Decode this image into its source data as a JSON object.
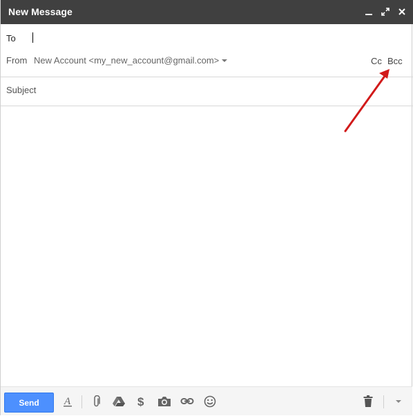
{
  "window": {
    "title": "New Message"
  },
  "compose": {
    "to_label": "To",
    "from_label": "From",
    "from_value": "New Account <my_new_account@gmail.com>",
    "cc_label": "Cc",
    "bcc_label": "Bcc",
    "subject_placeholder": "Subject"
  },
  "toolbar": {
    "send_label": "Send",
    "icons": [
      "formatting-icon",
      "attach-icon",
      "drive-icon",
      "money-icon",
      "photo-icon",
      "link-icon",
      "emoji-icon",
      "trash-icon",
      "more-options-icon"
    ]
  },
  "colors": {
    "titlebar": "#404040",
    "send_button": "#4d90fe",
    "annotation_arrow": "#d11a1a"
  }
}
